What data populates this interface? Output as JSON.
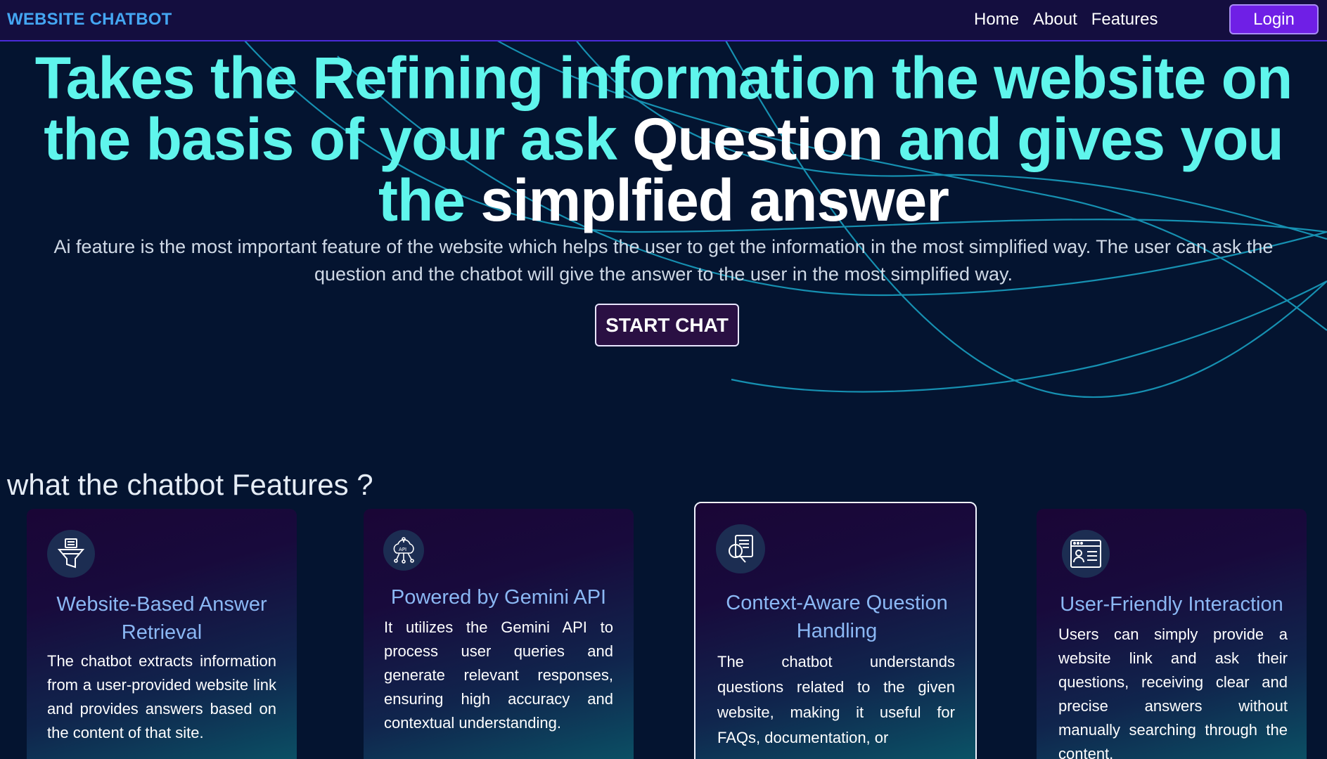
{
  "nav": {
    "brand": "WEBSITE CHATBOT",
    "links": [
      "Home",
      "About",
      "Features"
    ],
    "login_label": "Login"
  },
  "hero": {
    "title_part1": "Takes the Refining information the website on the basis of your ask ",
    "title_highlight1": "Question",
    "title_part2": " and gives you the ",
    "title_highlight2": "simplfied answer",
    "subtitle": "Ai feature is the most important feature of the website which helps the user to get the information in the most simplified way. The user can ask the question and the chatbot will give the answer to the user in the most simplified way.",
    "cta_label": "START CHAT"
  },
  "features": {
    "heading": "what the chatbot Features ?",
    "cards": [
      {
        "icon": "funnel-document-icon",
        "title": "Website-Based Answer Retrieval",
        "text": "The chatbot extracts information from a user-provided website link and provides answers based on the content of that site."
      },
      {
        "icon": "api-cloud-icon",
        "title": "Powered by Gemini API",
        "text": "It utilizes the Gemini API to process user queries and generate relevant responses, ensuring high accuracy and contextual understanding."
      },
      {
        "icon": "document-search-icon",
        "title": "Context-Aware Question Handling",
        "text": "The chatbot understands questions related to the given website, making it useful for FAQs, documentation, or"
      },
      {
        "icon": "profile-window-icon",
        "title": "User-Friendly Interaction",
        "text": "Users can simply provide a website link and ask their questions, receiving clear and precise answers without manually searching through the content."
      }
    ]
  },
  "colors": {
    "background": "#041430",
    "navbar": "#140e3f",
    "accent_cyan": "#5ff5ec",
    "brand_blue": "#44a6f2",
    "login_purple": "#6f1fe6",
    "card_title": "#8bb8f4"
  }
}
